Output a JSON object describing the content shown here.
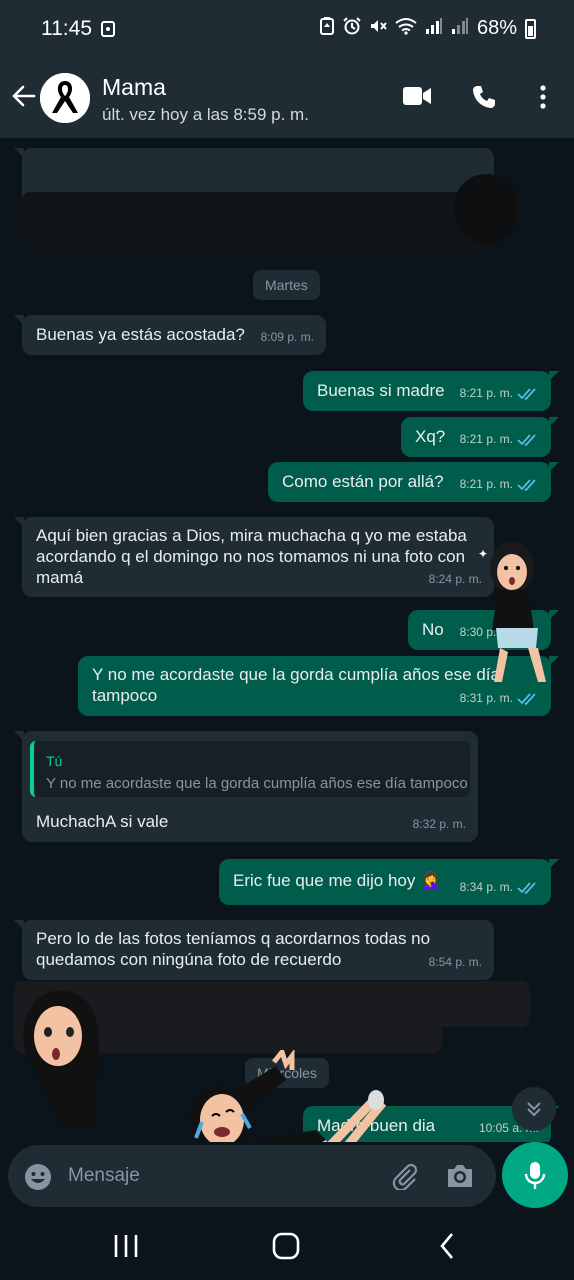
{
  "status_bar": {
    "time": "11:45",
    "battery": "68%"
  },
  "header": {
    "name": "Mama",
    "status": "últ. vez hoy a las 8:59 p. m."
  },
  "dates": {
    "tuesday": "Martes",
    "wednesday": "Miércoles"
  },
  "messages": [
    {
      "dir": "in",
      "text": "Buenas ya estás acostada?",
      "time": "8:09 p. m."
    },
    {
      "dir": "out",
      "text": "Buenas si madre",
      "time": "8:21 p. m."
    },
    {
      "dir": "out",
      "text": "Xq?",
      "time": "8:21 p. m."
    },
    {
      "dir": "out",
      "text": "Como están por allá?",
      "time": "8:21 p. m."
    },
    {
      "dir": "in",
      "text": "Aquí bien gracias a Dios, mira muchacha q yo me estaba\nacordando q el domingo no nos tomamos ni una foto con\nmamá",
      "time": "8:24 p. m."
    },
    {
      "dir": "out",
      "text": "No",
      "time": "8:30 p. m."
    },
    {
      "dir": "out",
      "text": "Y no me acordaste que la gorda cumplía años ese día\ntampoco",
      "time": "8:31 p. m."
    },
    {
      "dir": "in",
      "text": "MuchachA si vale",
      "time": "8:32 p. m.",
      "quote_author": "Tú",
      "quote_text": "Y no me acordaste que la gorda cumplía años ese día tampoco"
    },
    {
      "dir": "out",
      "text": "Eric fue que me dijo hoy 🤦‍♀️",
      "time": "8:34 p. m."
    },
    {
      "dir": "in",
      "text": "Pero lo de las fotos teníamos q acordarnos todas no\nquedamos con ningúna foto de recuerdo",
      "time": "8:54 p. m."
    },
    {
      "dir": "out",
      "text": "Madre buen dia",
      "time": "10:05 a. m."
    }
  ],
  "input": {
    "placeholder": "Mensaje"
  },
  "icons": {
    "back": "arrow-left-icon",
    "video": "video-call-icon",
    "call": "phone-icon",
    "menu": "more-vert-icon",
    "emoji": "emoji-icon",
    "attach": "paperclip-icon",
    "camera": "camera-icon",
    "mic": "mic-icon",
    "read_receipt": "double-check-icon"
  },
  "colors": {
    "header_bg": "#1f2c34",
    "chat_bg": "#0b141a",
    "incoming_bubble": "#1f2c34",
    "outgoing_bubble": "#005c4b",
    "read_tick": "#53bdeb",
    "accent": "#00a884"
  }
}
